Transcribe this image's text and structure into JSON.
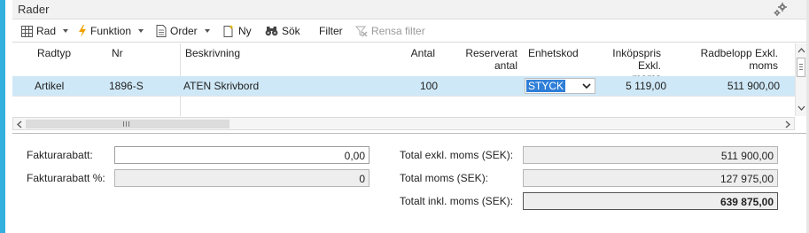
{
  "panel": {
    "title": "Rader"
  },
  "toolbar": {
    "rad": "Rad",
    "funktion": "Funktion",
    "order": "Order",
    "ny": "Ny",
    "sok": "Sök",
    "filter": "Filter",
    "rensa_filter": "Rensa filter"
  },
  "grid": {
    "headers": {
      "radtyp": "Radtyp",
      "nr": "Nr",
      "beskrivning": "Beskrivning",
      "antal": "Antal",
      "reserverat_l1": "Reserverat",
      "reserverat_l2": "antal",
      "enhetskod": "Enhetskod",
      "inkopspris_l1": "Inköpspris Exkl.",
      "inkopspris_l2": "moms",
      "radbelopp_l1": "Radbelopp Exkl.",
      "radbelopp_l2": "moms"
    },
    "rows": [
      {
        "radtyp": "Artikel",
        "nr": "1896-S",
        "beskrivning": "ATEN Skrivbord",
        "antal": "100",
        "reserverat": "",
        "enhetskod": "STYCK",
        "inkopspris": "5 119,00",
        "radbelopp": "511 900,00"
      }
    ]
  },
  "totals": {
    "fakturarabatt_label": "Fakturarabatt:",
    "fakturarabatt_value": "0,00",
    "fakturarabatt_pct_label": "Fakturarabatt %:",
    "fakturarabatt_pct_value": "0",
    "total_exkl_label": "Total exkl. moms (SEK):",
    "total_exkl_value": "511 900,00",
    "total_moms_label": "Total moms (SEK):",
    "total_moms_value": "127 975,00",
    "total_inkl_label": "Totalt inkl. moms (SEK):",
    "total_inkl_value": "639 875,00"
  },
  "colors": {
    "accent": "#33b0de",
    "row_selected": "#cfe8f7",
    "selection": "#2f7fd8"
  }
}
